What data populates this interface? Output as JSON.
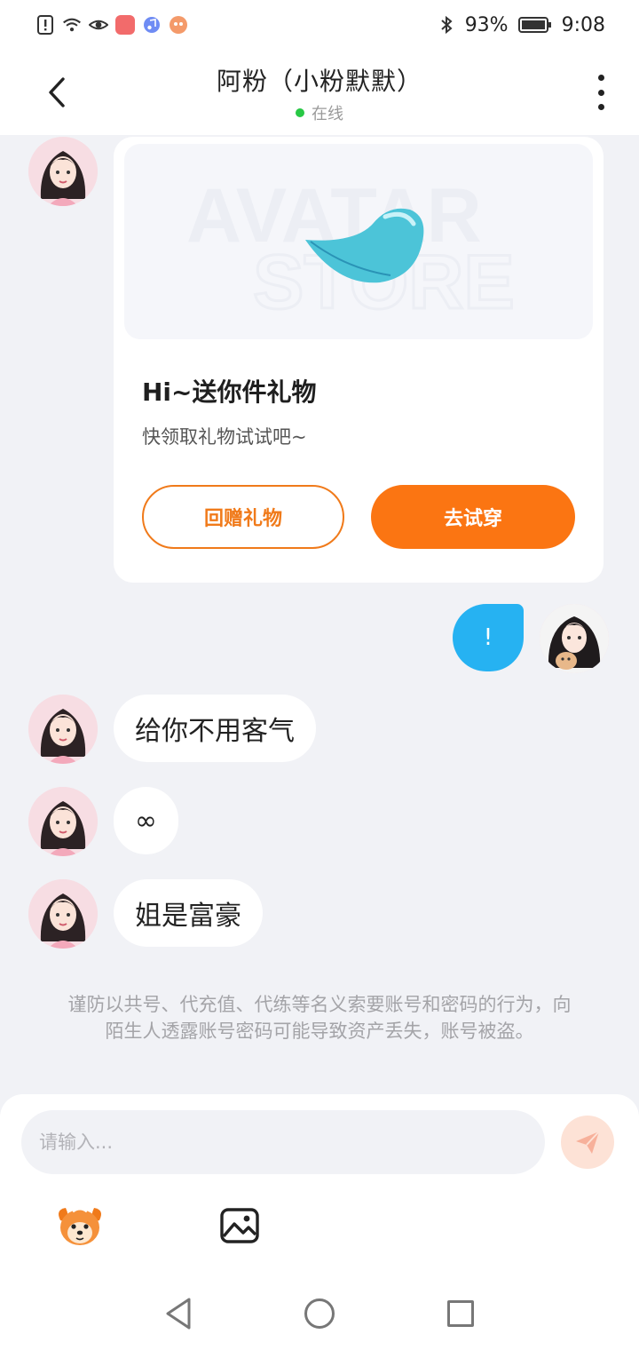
{
  "status_bar": {
    "battery": "93%",
    "time": "9:08",
    "icons": [
      "notification-alert-icon",
      "wifi-icon",
      "eye-icon",
      "app-badge-icon",
      "music-icon",
      "game-icon",
      "bluetooth-icon",
      "battery-icon"
    ]
  },
  "header": {
    "title": "阿粉（小粉默默）",
    "status": "在线",
    "status_color": "#28c845"
  },
  "gift_card": {
    "title": "Hi~送你件礼物",
    "subtitle": "快领取礼物试试吧~",
    "return_button": "回赠礼物",
    "try_button": "去试穿",
    "accent_color": "#fb7512"
  },
  "messages": [
    {
      "from": "me",
      "text": "!"
    },
    {
      "from": "them",
      "text": "给你不用客气"
    },
    {
      "from": "them",
      "text": "∞"
    },
    {
      "from": "them",
      "text": "姐是富豪"
    }
  ],
  "warning": "谨防以共号、代充值、代练等名义索要账号和密码的行为，向陌生人透露账号密码可能导致资产丢失，账号被盗。",
  "input": {
    "placeholder": "请输入..."
  }
}
